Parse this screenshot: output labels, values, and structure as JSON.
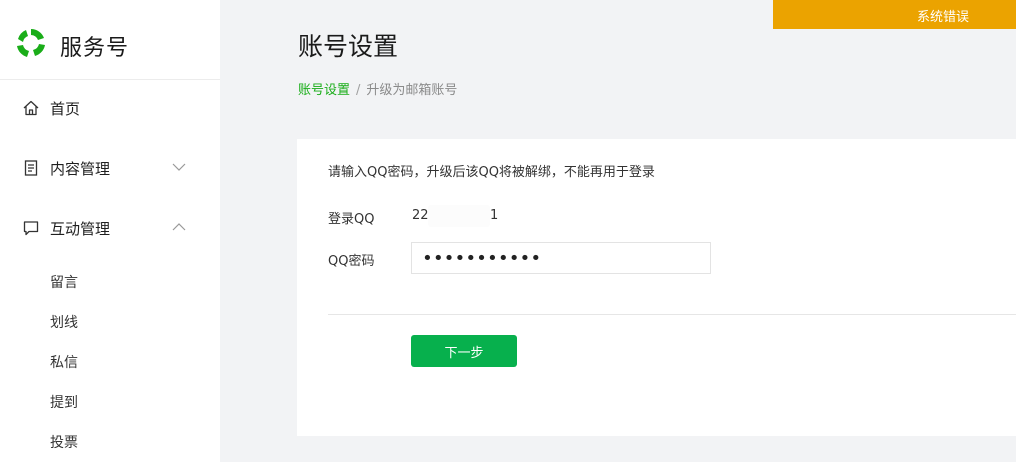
{
  "sidebar": {
    "brand": {
      "name": "服务号",
      "logo_icon": "service-account-logo"
    },
    "items": [
      {
        "label": "首页",
        "icon": "home-icon"
      },
      {
        "label": "内容管理",
        "icon": "document-icon",
        "chevron": "down"
      },
      {
        "label": "互动管理",
        "icon": "chat-icon",
        "chevron": "up"
      }
    ],
    "sub_items": [
      "留言",
      "划线",
      "私信",
      "提到",
      "投票"
    ]
  },
  "header": {
    "title": "账号设置",
    "breadcrumb": {
      "link": "账号设置",
      "separator": "/",
      "current": "升级为邮箱账号"
    }
  },
  "alert": {
    "text": "系统错误",
    "color": "#eba300"
  },
  "form": {
    "instruction": "请输入QQ密码，升级后该QQ将被解绑，不能再用于登录",
    "qq_label": "登录QQ",
    "qq_value_start": "22",
    "qq_value_end": "1",
    "password_label": "QQ密码",
    "password_value": "•••••••••••",
    "next_button": "下一步"
  },
  "colors": {
    "accent": "#1aad19",
    "button": "#07b04d",
    "alert": "#eba300"
  }
}
